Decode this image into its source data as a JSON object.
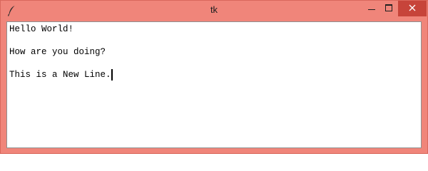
{
  "window": {
    "title": "tk",
    "accent": "#f0857a",
    "close_color": "#c7443a"
  },
  "icons": {
    "app": "feather-icon",
    "minimize": "minimize-icon",
    "maximize": "maximize-icon",
    "close": "close-icon"
  },
  "text_widget": {
    "lines": [
      "Hello World!",
      "",
      "How are you doing?",
      "",
      "This is a New Line."
    ]
  }
}
